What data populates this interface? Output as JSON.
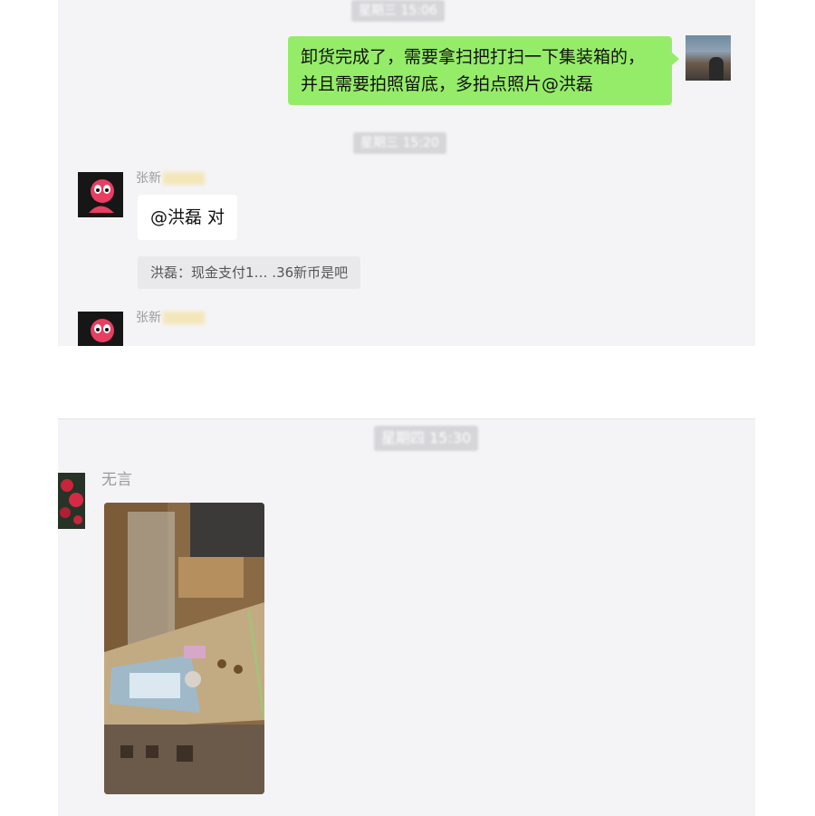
{
  "chat": {
    "timestamps": [
      "星期三 15:06",
      "星期三 15:20",
      "星期四 15:30"
    ],
    "outgoing_message": "卸货完成了，需要拿扫把打扫一下集装箱的，并且需要拍照留底，多拍点照片@洪磊",
    "reply_sender": "张新",
    "reply_text": "@洪磊 对",
    "quoted_text": "洪磊：现金支付1… .36新币是吧",
    "second_sender": "张新",
    "photo_sender": "无言"
  },
  "colors": {
    "panel_bg": "#f4f4f6",
    "outgoing_bubble": "#95ec69",
    "incoming_bubble": "#ffffff"
  }
}
